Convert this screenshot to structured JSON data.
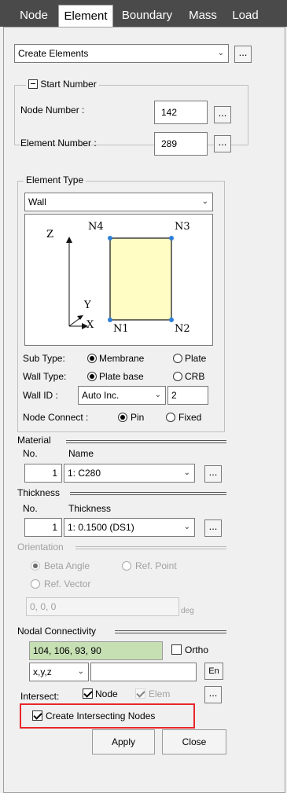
{
  "tabs": [
    "Node",
    "Element",
    "Boundary",
    "Mass",
    "Load"
  ],
  "active_tab": "Element",
  "mode_select": "Create Elements",
  "ellipsis": "...",
  "start_number": {
    "legend": "Start Number",
    "node_label": "Node Number   :",
    "node_value": "142",
    "element_label": "Element Number :",
    "element_value": "289"
  },
  "element_type": {
    "legend": "Element Type",
    "value": "Wall",
    "diagram": {
      "z": "Z",
      "y": "Y",
      "x": "X",
      "n1": "N1",
      "n2": "N2",
      "n3": "N3",
      "n4": "N4"
    },
    "sub_type_label": "Sub Type:",
    "sub_type_options": [
      "Membrane",
      "Plate"
    ],
    "wall_type_label": "Wall Type:",
    "wall_type_options": [
      "Plate base",
      "CRB"
    ],
    "wall_id_label": "Wall ID :",
    "wall_id_mode": "Auto Inc.",
    "wall_id_value": "2",
    "node_connect_label": "Node Connect :",
    "node_connect_options": [
      "Pin",
      "Fixed"
    ]
  },
  "material": {
    "title": "Material",
    "col_no": "No.",
    "col_name": "Name",
    "no": "1",
    "name": "1: C280"
  },
  "thickness": {
    "title": "Thickness",
    "col_no": "No.",
    "col_name": "Thickness",
    "no": "1",
    "name": "1: 0.1500 (DS1)"
  },
  "orientation": {
    "title": "Orientation",
    "opt_beta": "Beta Angle",
    "opt_ref_point": "Ref. Point",
    "opt_ref_vector": "Ref. Vector",
    "value": "0, 0, 0",
    "unit": "deg"
  },
  "nodal": {
    "title": "Nodal Connectivity",
    "value": "104, 106, 93, 90",
    "ortho": "Ortho",
    "coord": "x,y,z",
    "en": "En"
  },
  "intersect": {
    "label": "Intersect:",
    "node": "Node",
    "elem": "Elem",
    "create_nodes": "Create Intersecting Nodes"
  },
  "buttons": {
    "apply": "Apply",
    "close": "Close"
  },
  "colors": {
    "highlight": "#e8272b",
    "connectivity_bg": "#c6e0b4",
    "wall_fill": "#fffcc4",
    "node_dot": "#2f7fd8"
  }
}
